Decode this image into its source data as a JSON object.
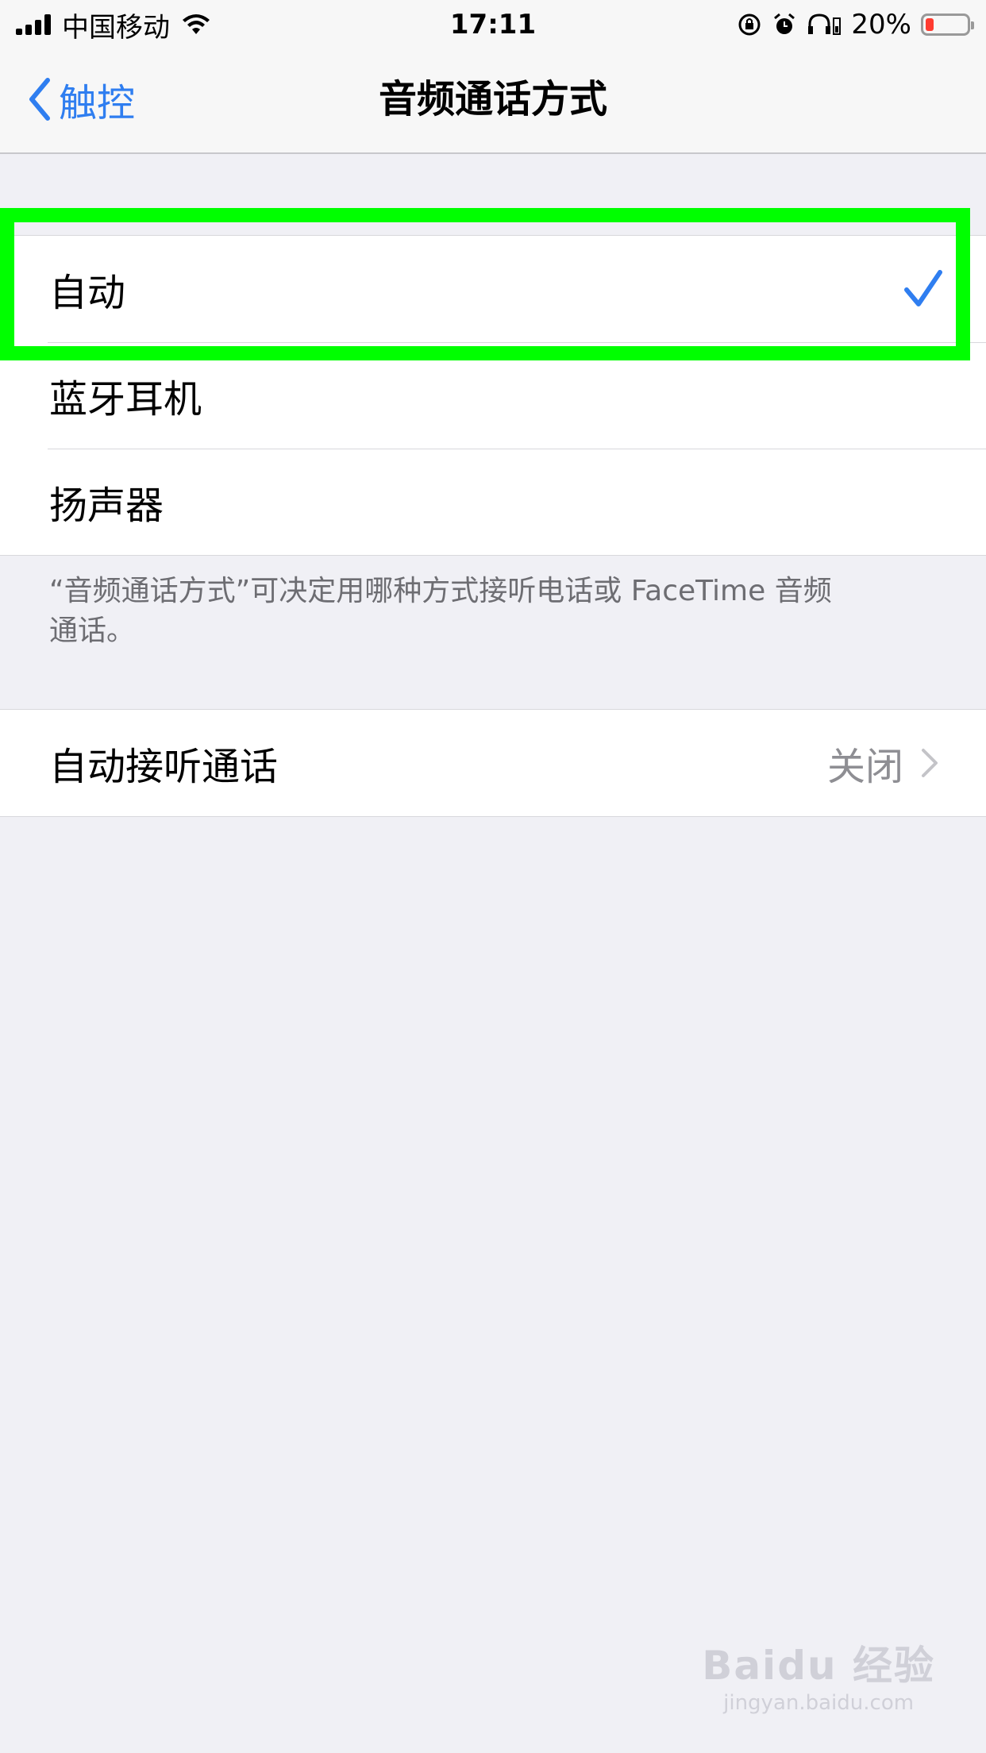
{
  "status_bar": {
    "carrier": "中国移动",
    "time": "17:11",
    "battery_percent": "20%",
    "battery_level": 0.2,
    "battery_color": "#ff3b30",
    "icons": [
      "signal-icon",
      "wifi-icon",
      "rotation-lock-icon",
      "alarm-icon",
      "headphones-icon",
      "battery-icon"
    ]
  },
  "nav": {
    "back_label": "触控",
    "title": "音频通话方式"
  },
  "routing_options": [
    {
      "label": "自动",
      "selected": true
    },
    {
      "label": "蓝牙耳机",
      "selected": false
    },
    {
      "label": "扬声器",
      "selected": false
    }
  ],
  "footer_note": "“音频通话方式”可决定用哪种方式接听电话或 FaceTime 音频通话。",
  "auto_answer": {
    "label": "自动接听通话",
    "value": "关闭"
  },
  "watermark": {
    "logo": "Baidu 经验",
    "url": "jingyan.baidu.com"
  },
  "colors": {
    "accent": "#2f7ef0",
    "highlight": "#00ff00",
    "background": "#f0f0f5"
  }
}
